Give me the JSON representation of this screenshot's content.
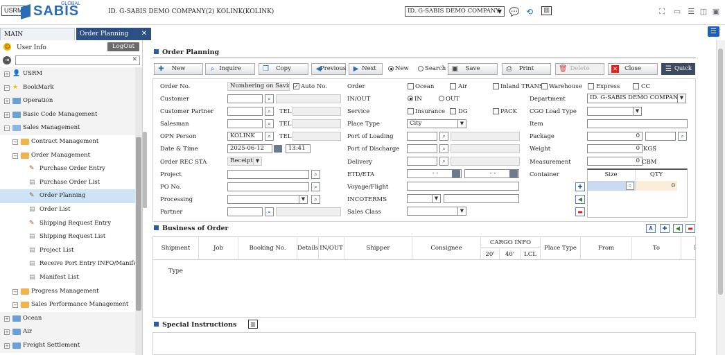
{
  "header": {
    "app_button": "USRM",
    "logo_text": "SABIS",
    "logo_sup": "GLOBAL",
    "company_title": "ID. G-SABIS DEMO COMPANY(2) KOLINK(KOLINK)",
    "company_select": "ID. G-SABIS DEMO COMPANY"
  },
  "tabs": [
    {
      "label": "MAIN"
    },
    {
      "label": "Order Planning"
    }
  ],
  "sidebar": {
    "user_info": "User Info",
    "logout": "LogOut",
    "tree": [
      {
        "label": "USRM",
        "level": 0,
        "icon": "user"
      },
      {
        "label": "BookMark",
        "level": 0,
        "icon": "star"
      },
      {
        "label": "Operation",
        "level": 0,
        "icon": "folder"
      },
      {
        "label": "Basic Code Management",
        "level": 0,
        "icon": "folder"
      },
      {
        "label": "Sales Management",
        "level": 0,
        "icon": "folder-open"
      },
      {
        "label": "Contract Management",
        "level": 1,
        "icon": "folder-open"
      },
      {
        "label": "Order Management",
        "level": 1,
        "icon": "folder-open"
      },
      {
        "label": "Purchase Order Entry",
        "level": 2,
        "icon": "pen"
      },
      {
        "label": "Purchase Order List",
        "level": 2,
        "icon": "doc"
      },
      {
        "label": "Order Planning",
        "level": 2,
        "icon": "pen",
        "selected": true
      },
      {
        "label": "Order List",
        "level": 2,
        "icon": "doc"
      },
      {
        "label": "Shipping Request Entry",
        "level": 2,
        "icon": "pen"
      },
      {
        "label": "Shipping Request List",
        "level": 2,
        "icon": "doc"
      },
      {
        "label": "Project List",
        "level": 2,
        "icon": "doc"
      },
      {
        "label": "Receive Port Entry INFO/Manifest",
        "level": 2,
        "icon": "doc"
      },
      {
        "label": "Manifest List",
        "level": 2,
        "icon": "doc"
      },
      {
        "label": "Progress Management",
        "level": 1,
        "icon": "folder-open"
      },
      {
        "label": "Sales Performance Management",
        "level": 1,
        "icon": "folder-open"
      },
      {
        "label": "Ocean",
        "level": 0,
        "icon": "folder"
      },
      {
        "label": "Air",
        "level": 0,
        "icon": "folder"
      },
      {
        "label": "Freight Settlement",
        "level": 0,
        "icon": "folder"
      }
    ]
  },
  "order_planning": {
    "title": "Order Planning",
    "toolbar": {
      "new": "New",
      "inquire": "Inquire",
      "copy": "Copy",
      "previous": "Previous",
      "next": "Next",
      "radio_new": "New",
      "radio_search": "Search",
      "save": "Save",
      "print": "Print",
      "delete": "Delete",
      "close": "Close",
      "quick": "Quick"
    },
    "labels": {
      "order_no": "Order No.",
      "customer": "Customer",
      "customer_partner": "Customer Partner",
      "salesman": "Salesman",
      "opn_person": "OPN Person",
      "date_time": "Date & Time",
      "order_rec_sta": "Order REC STA",
      "project": "Project",
      "po_no": "PO No.",
      "processing": "Processing",
      "partner": "Partner",
      "tel": "TEL",
      "order": "Order",
      "in_out": "IN/OUT",
      "service": "Service",
      "place_type": "Place Type",
      "port_loading": "Port of Loading",
      "port_discharge": "Port of Discharge",
      "delivery": "Delivery",
      "etd_eta": "ETD/ETA",
      "voyage": "Voyage/Flight",
      "incoterms": "INCOTERMS",
      "sales_class": "Sales Class",
      "department": "Department",
      "cgo_load_type": "CGO Load Type",
      "item": "Item",
      "package": "Package",
      "weight": "Weight",
      "measurement": "Measurement",
      "container": "Container",
      "auto_no": "Auto No.",
      "ocean": "Ocean",
      "air": "Air",
      "inland": "Inland TRANS",
      "warehouse": "Warehouse",
      "express": "Express",
      "cc": "CC",
      "in": "IN",
      "out": "OUT",
      "insurance": "Insurance",
      "dg": "DG",
      "pack": "PACK",
      "kgs": "KGS",
      "cbm": "CBM",
      "size": "Size",
      "qty": "QTY"
    },
    "values": {
      "order_no": "Numbering on Saving",
      "opn_person": "KOLINK",
      "date": "2025-06-12",
      "time": "13:41",
      "order_rec_sta": "Receipt",
      "place_type": "City",
      "etd": "- -",
      "eta": "- -",
      "department": "ID. G-SABIS DEMO COMPANY",
      "package_qty": "0",
      "weight": "0",
      "measurement": "0",
      "container_qty": "0"
    }
  },
  "business_of_order": {
    "title": "Business of Order",
    "columns": [
      "Shipment Type",
      "Job",
      "Booking No.",
      "Details",
      "IN/OUT",
      "Shipper",
      "Consignee",
      "CARGO INFO",
      "Place Type",
      "From",
      "To",
      "Lo"
    ],
    "cargo_sub": [
      "20'",
      "40'",
      "LCL"
    ]
  },
  "special_instructions": {
    "title": "Special Instructions"
  }
}
